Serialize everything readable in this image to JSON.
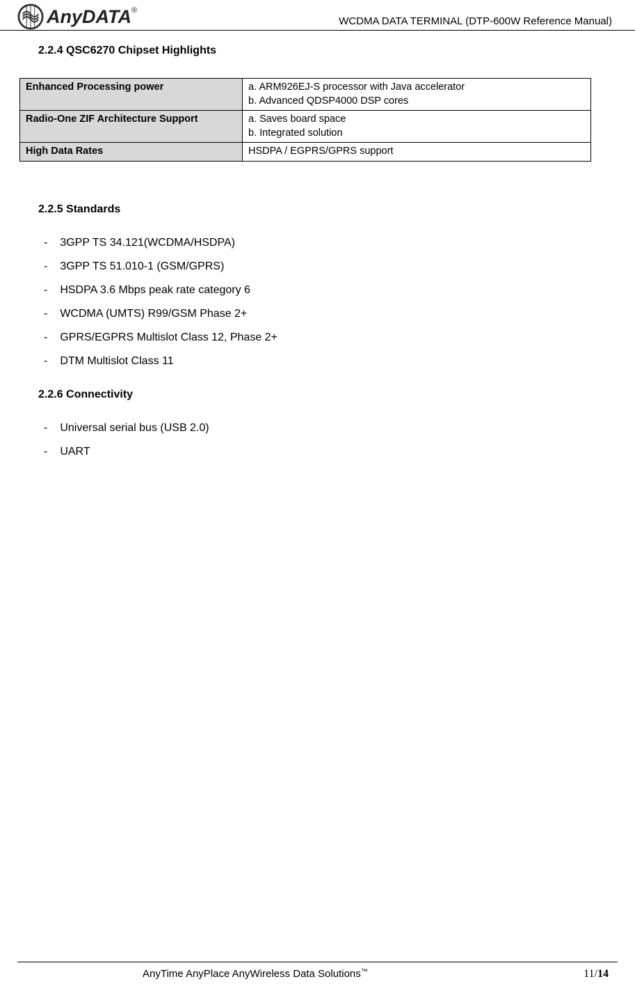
{
  "header": {
    "logo_text": "AnyDATA",
    "doc_title": "WCDMA DATA TERMINAL (DTP-600W Reference Manual)"
  },
  "sections": {
    "highlights": {
      "heading": "2.2.4 QSC6270 Chipset Highlights",
      "table": [
        {
          "label": "Enhanced Processing power",
          "value": "a. ARM926EJ-S processor with Java accelerator\nb. Advanced QDSP4000 DSP cores"
        },
        {
          "label": "Radio-One ZIF Architecture Support",
          "value": "a. Saves board space\nb. Integrated solution"
        },
        {
          "label": "High Data Rates",
          "value": "HSDPA / EGPRS/GPRS support"
        }
      ]
    },
    "standards": {
      "heading": "2.2.5 Standards",
      "items": [
        "3GPP TS 34.121(WCDMA/HSDPA)",
        "3GPP TS 51.010-1 (GSM/GPRS)",
        "HSDPA 3.6 Mbps peak rate category 6",
        "WCDMA (UMTS) R99/GSM Phase 2+",
        "GPRS/EGPRS Multislot Class 12, Phase 2+",
        "DTM Multislot Class 11"
      ]
    },
    "connectivity": {
      "heading": "2.2.6 Connectivity",
      "items": [
        "Universal serial bus (USB 2.0)",
        "UART"
      ]
    }
  },
  "footer": {
    "tagline": "AnyTime AnyPlace AnyWireless Data Solutions",
    "page_current": "11",
    "page_sep": "/",
    "page_total": "14"
  }
}
